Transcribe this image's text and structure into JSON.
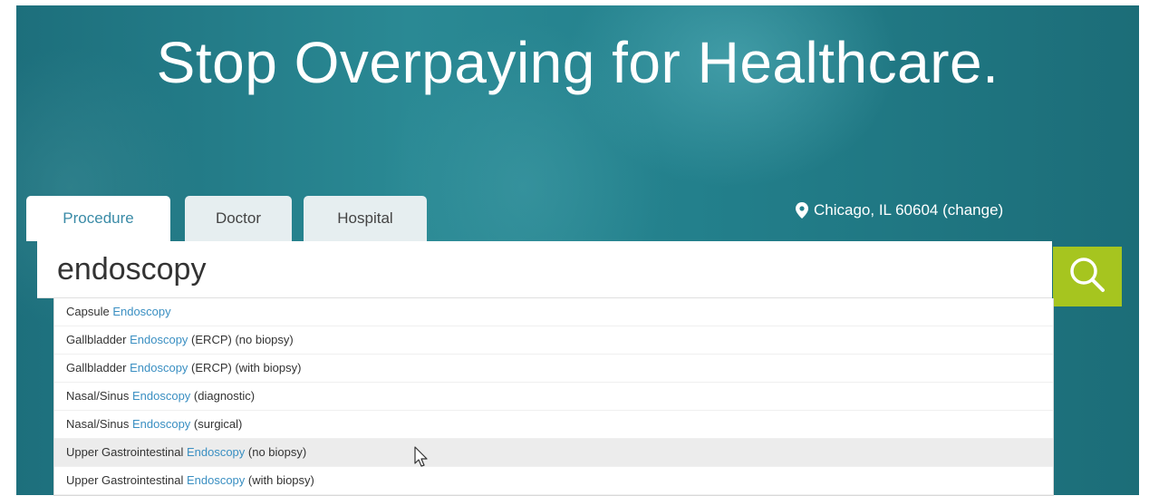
{
  "hero": {
    "title": "Stop Overpaying for Healthcare."
  },
  "location": {
    "text": "Chicago, IL 60604 (change)",
    "icon": "map-pin-icon"
  },
  "tabs": [
    {
      "label": "Procedure",
      "active": true
    },
    {
      "label": "Doctor",
      "active": false
    },
    {
      "label": "Hospital",
      "active": false
    }
  ],
  "search": {
    "value": "endoscopy",
    "button_icon": "search-icon",
    "button_color": "#a6c51f"
  },
  "suggestions": [
    {
      "pre": "Capsule ",
      "match": "Endoscopy",
      "post": ""
    },
    {
      "pre": "Gallbladder ",
      "match": "Endoscopy",
      "post": " (ERCP) (no biopsy)"
    },
    {
      "pre": "Gallbladder ",
      "match": "Endoscopy",
      "post": " (ERCP) (with biopsy)"
    },
    {
      "pre": "Nasal/Sinus ",
      "match": "Endoscopy",
      "post": " (diagnostic)"
    },
    {
      "pre": "Nasal/Sinus ",
      "match": "Endoscopy",
      "post": " (surgical)"
    },
    {
      "pre": "Upper Gastrointestinal ",
      "match": "Endoscopy",
      "post": " (no biopsy)"
    },
    {
      "pre": "Upper Gastrointestinal ",
      "match": "Endoscopy",
      "post": " (with biopsy)"
    }
  ],
  "colors": {
    "accent": "#3a8ba7",
    "highlight": "#3a8fc2",
    "hero_bg": "#23808c"
  }
}
